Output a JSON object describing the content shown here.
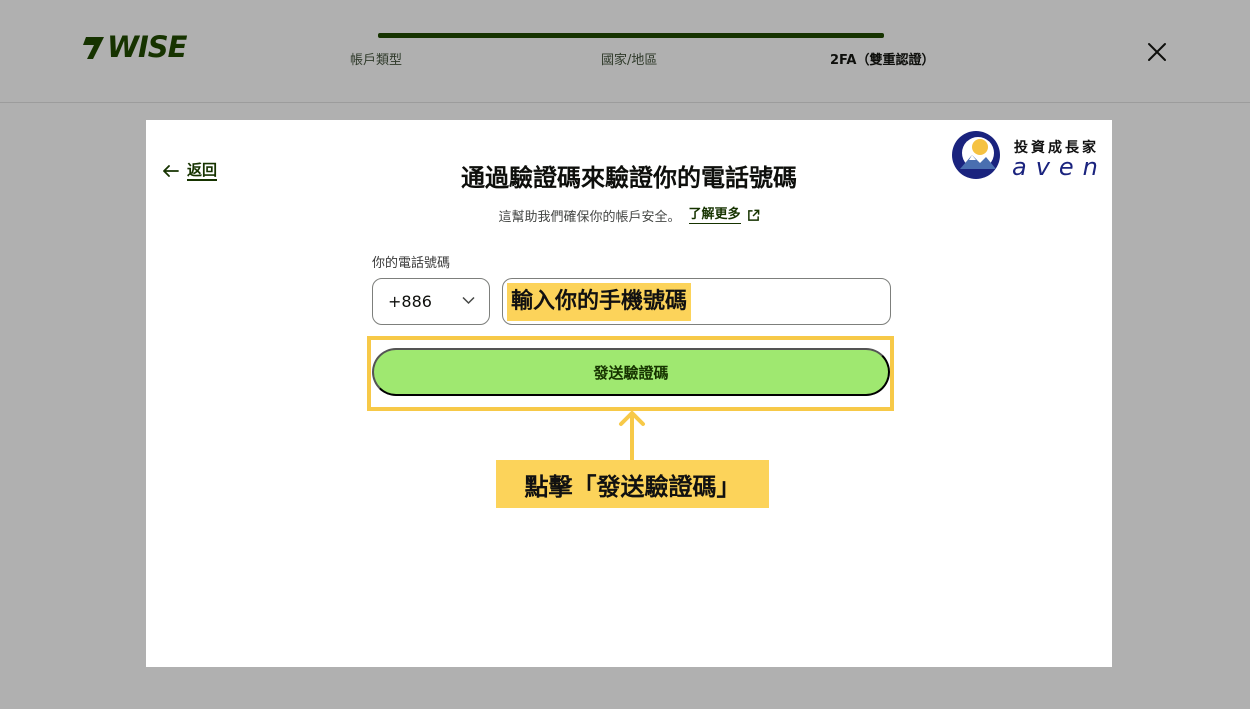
{
  "brand": {
    "name": "WISE"
  },
  "steps": [
    "帳戶類型",
    "國家/地區",
    "2FA（雙重認證）"
  ],
  "card": {
    "back_label": "返回",
    "title": "通過驗證碼來驗證你的電話號碼",
    "subtitle": "這幫助我們確保你的帳戶安全。",
    "learn_more": "了解更多",
    "phone": {
      "label": "你的電話號碼",
      "country_code": "+886",
      "input_hint": "輸入你的手機號碼"
    },
    "send_button": "發送驗證碼"
  },
  "annotation": {
    "callout": "點擊「發送驗證碼」"
  },
  "watermark": {
    "top_text": "投資成長家",
    "bottom_text": "aven"
  },
  "colors": {
    "overlay": "#b0b0b0",
    "brand_dark_green": "#163300",
    "button_green": "#9fe870",
    "highlight_yellow": "#f7c948",
    "watermark_blue": "#1a237e"
  },
  "icons": [
    "wise-flag-icon",
    "close-icon",
    "arrow-left-icon",
    "external-link-icon",
    "chevron-down-icon",
    "arrow-up-icon"
  ]
}
